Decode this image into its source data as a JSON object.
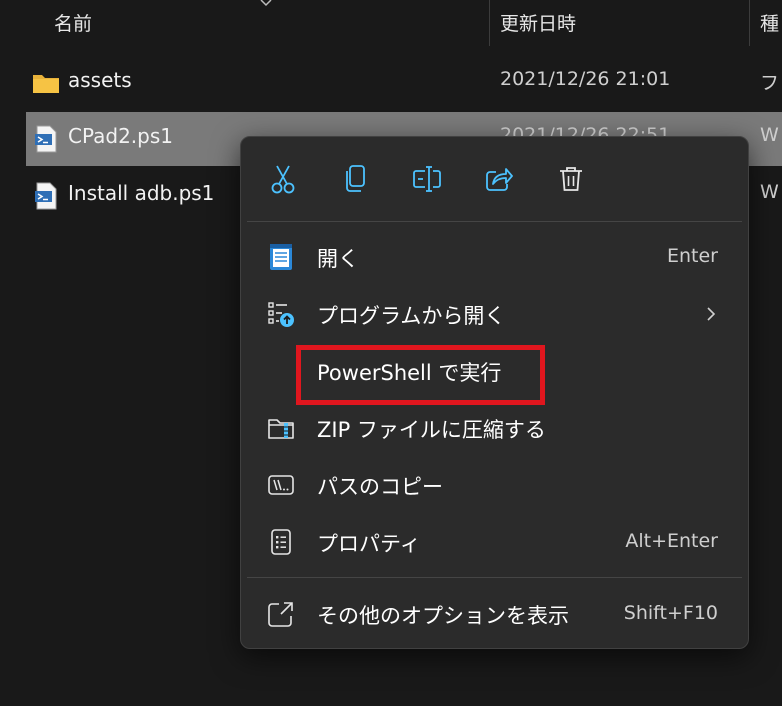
{
  "columns": {
    "name": "名前",
    "modified": "更新日時",
    "type": "種"
  },
  "files": [
    {
      "name": "assets",
      "date": "2021/12/26 21:01",
      "type": "ファ",
      "icon": "folder-icon"
    },
    {
      "name": "CPad2.ps1",
      "date": "2021/12/26 22:51",
      "type": "W",
      "icon": "powershell-script-icon"
    },
    {
      "name": "Install adb.ps1",
      "date": "",
      "type": "W",
      "icon": "powershell-script-icon"
    }
  ],
  "context_menu": {
    "quick_actions": [
      {
        "name": "cut",
        "icon": "scissors-icon"
      },
      {
        "name": "copy",
        "icon": "copy-icon"
      },
      {
        "name": "rename",
        "icon": "rename-icon"
      },
      {
        "name": "share",
        "icon": "share-icon"
      },
      {
        "name": "delete",
        "icon": "trash-icon"
      }
    ],
    "items": [
      {
        "label": "開く",
        "shortcut": "Enter",
        "icon": "notepad-icon"
      },
      {
        "label": "プログラムから開く",
        "shortcut": "",
        "icon": "open-with-icon",
        "submenu": true
      },
      {
        "label": "PowerShell で実行",
        "shortcut": "",
        "icon": ""
      },
      {
        "label": "ZIP ファイルに圧縮する",
        "shortcut": "",
        "icon": "zip-folder-icon"
      },
      {
        "label": "パスのコピー",
        "shortcut": "",
        "icon": "copy-path-icon"
      },
      {
        "label": "プロパティ",
        "shortcut": "Alt+Enter",
        "icon": "properties-icon"
      }
    ],
    "more_options": {
      "label": "その他のオプションを表示",
      "shortcut": "Shift+F10",
      "icon": "more-options-icon"
    }
  },
  "colors": {
    "background": "#191919",
    "menu_background": "#2b2b2b",
    "accent_icon": "#4cc2ff",
    "selection": "#7a7a7a",
    "highlight": "#e0161e",
    "folder": "#f6c344"
  }
}
